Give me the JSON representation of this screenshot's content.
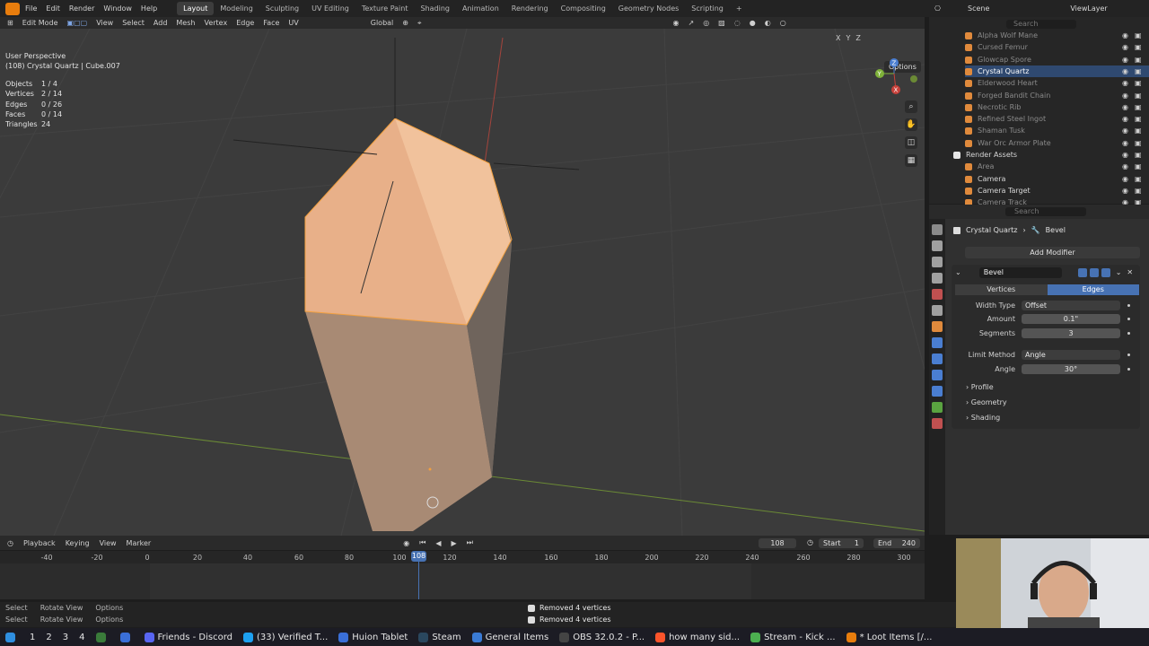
{
  "menu": [
    "File",
    "Edit",
    "Render",
    "Window",
    "Help"
  ],
  "workspaces": [
    "Layout",
    "Modeling",
    "Sculpting",
    "UV Editing",
    "Texture Paint",
    "Shading",
    "Animation",
    "Rendering",
    "Compositing",
    "Geometry Nodes",
    "Scripting"
  ],
  "active_workspace": "Layout",
  "scene_label": "Scene",
  "viewlayer_label": "ViewLayer",
  "editor_header": {
    "mode": "Edit Mode",
    "items": [
      "View",
      "Select",
      "Add",
      "Mesh",
      "Vertex",
      "Edge",
      "Face",
      "UV"
    ],
    "orientation": "Global"
  },
  "viewport": {
    "perspective": "User Perspective",
    "object_line": "(108) Crystal Quartz | Cube.007",
    "stats": [
      {
        "label": "Objects",
        "value": "1 / 4"
      },
      {
        "label": "Vertices",
        "value": "2 / 14"
      },
      {
        "label": "Edges",
        "value": "0 / 26"
      },
      {
        "label": "Faces",
        "value": "0 / 14"
      },
      {
        "label": "Triangles",
        "value": "24"
      }
    ],
    "axis_toggles": [
      "X",
      "Y",
      "Z"
    ],
    "options_label": "Options",
    "gizmo": {
      "x": "X",
      "y": "Y",
      "z": "Z"
    },
    "colors": {
      "mesh_light": "#f2c39a",
      "mesh_dark": "#8d7a6c",
      "grid": "#474747",
      "x_axis": "#c8413b",
      "y_axis": "#7fb23a"
    }
  },
  "outliner": {
    "search_placeholder": "Search",
    "items": [
      {
        "label": "Alpha Wolf Mane",
        "dim": true
      },
      {
        "label": "Cursed Femur",
        "dim": true
      },
      {
        "label": "Glowcap Spore",
        "dim": true
      },
      {
        "label": "Crystal Quartz",
        "dim": false,
        "selected": true
      },
      {
        "label": "Elderwood Heart",
        "dim": true
      },
      {
        "label": "Forged Bandit Chain",
        "dim": true
      },
      {
        "label": "Necrotic Rib",
        "dim": true
      },
      {
        "label": "Refined Steel Ingot",
        "dim": true
      },
      {
        "label": "Shaman Tusk",
        "dim": true
      },
      {
        "label": "War Orc Armor Plate",
        "dim": true
      },
      {
        "label": "Render Assets",
        "dim": false,
        "collection": true
      },
      {
        "label": "Area",
        "dim": true
      },
      {
        "label": "Camera",
        "dim": false
      },
      {
        "label": "Camera Target",
        "dim": false
      },
      {
        "label": "Camera Track",
        "dim": true
      }
    ]
  },
  "properties": {
    "search_placeholder": "Search",
    "object_name": "Crystal Quartz",
    "modifier_crumb": "Bevel",
    "add_modifier": "Add Modifier",
    "modifier_name": "Bevel",
    "affect_options": [
      "Vertices",
      "Edges"
    ],
    "affect_selected": "Edges",
    "fields": [
      {
        "label": "Width Type",
        "value": "Offset",
        "kind": "select"
      },
      {
        "label": "Amount",
        "value": "0.1\"",
        "kind": "num"
      },
      {
        "label": "Segments",
        "value": "3",
        "kind": "num"
      },
      {
        "label": "Limit Method",
        "value": "Angle",
        "kind": "select"
      },
      {
        "label": "Angle",
        "value": "30°",
        "kind": "num"
      }
    ],
    "subpanels": [
      "Profile",
      "Geometry",
      "Shading"
    ]
  },
  "timeline": {
    "menus": [
      "Playback",
      "Keying",
      "View",
      "Marker"
    ],
    "current_frame": "108",
    "start_label": "Start",
    "start": "1",
    "end_label": "End",
    "end": "240",
    "ticks": [
      "-40",
      "-20",
      "0",
      "20",
      "40",
      "60",
      "80",
      "100",
      "120",
      "140",
      "160",
      "180",
      "200",
      "220",
      "240",
      "260",
      "280",
      "300"
    ]
  },
  "status": {
    "line1": [
      "Select",
      "Rotate View",
      "Options"
    ],
    "line2": [
      "Select",
      "Rotate View",
      "Options"
    ],
    "notifications": [
      "Removed 4 vertices",
      "Removed 4 vertices"
    ]
  },
  "taskbar": {
    "numbers": [
      "1",
      "2",
      "3",
      "4"
    ],
    "items": [
      {
        "label": "Friends - Discord",
        "color": "#5865f2"
      },
      {
        "label": "(33) Verified T...",
        "color": "#1da1f2"
      },
      {
        "label": "Huion Tablet",
        "color": "#3a6fd8"
      },
      {
        "label": "Steam",
        "color": "#1b2838"
      },
      {
        "label": "General Items",
        "color": "#3a7bd5"
      },
      {
        "label": "OBS 32.0.2 - P...",
        "color": "#222"
      },
      {
        "label": "how many sid...",
        "color": "#fb542b"
      },
      {
        "label": "Stream - Kick ...",
        "color": "#4caf50"
      },
      {
        "label": "* Loot Items [/...",
        "color": "#e87d0d"
      }
    ]
  }
}
